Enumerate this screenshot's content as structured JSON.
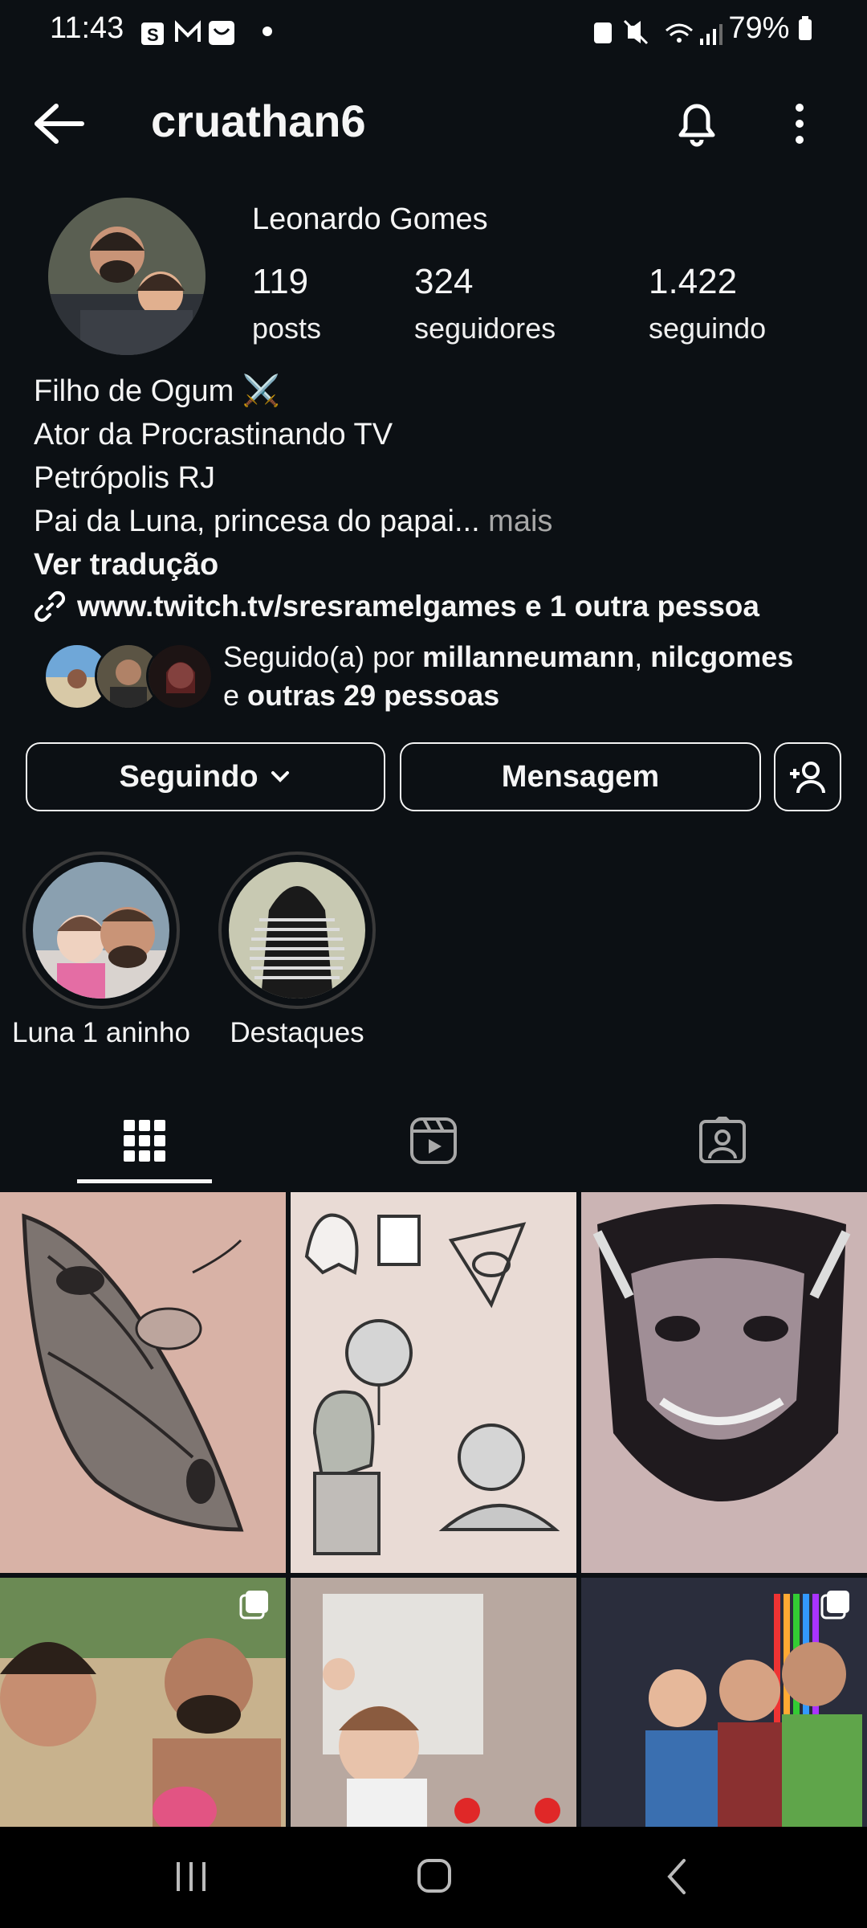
{
  "status_bar": {
    "time": "11:43",
    "battery": "79%",
    "notification_icons": [
      "shopping-bag-icon",
      "gmail-icon",
      "shopee-icon",
      "dot-icon"
    ],
    "system_icons": [
      "battery-saver-icon",
      "mute-icon",
      "wifi-icon",
      "signal-icon",
      "battery-icon"
    ]
  },
  "header": {
    "username": "cruathan6"
  },
  "profile": {
    "full_name": "Leonardo Gomes",
    "stats": [
      {
        "value": "119",
        "label": "posts"
      },
      {
        "value": "324",
        "label": "seguidores"
      },
      {
        "value": "1.422",
        "label": "seguindo"
      }
    ],
    "bio_lines": [
      "Filho de Ogum ⚔️",
      "Ator da Procrastinando TV",
      "Petrópolis RJ",
      "Pai da Luna, princesa do papai..."
    ],
    "bio_more": " mais",
    "translate": "Ver tradução",
    "link": "www.twitch.tv/sresramelgames e 1 outra pessoa",
    "followed_by_prefix": "Seguido(a) por ",
    "followed_by_user1": "millanneumann",
    "followed_by_sep": ", ",
    "followed_by_user2": "nilcgomes",
    "followed_by_and": "e ",
    "followed_by_others": "outras 29 pessoas"
  },
  "actions": {
    "following": "Seguindo",
    "message": "Mensagem"
  },
  "highlights": [
    {
      "label": "Luna 1 aninho"
    },
    {
      "label": "Destaques"
    }
  ],
  "tabs": [
    "grid-icon",
    "reels-icon",
    "tagged-icon"
  ],
  "colors": {
    "background": "#0c1014",
    "text": "#f5f5f5",
    "muted": "#a8a8a8"
  }
}
